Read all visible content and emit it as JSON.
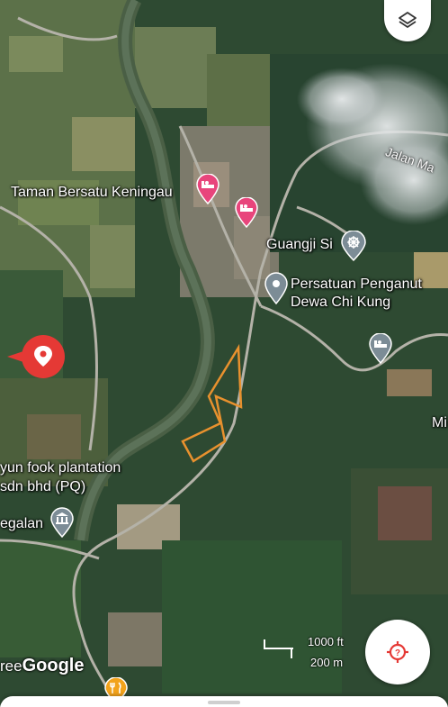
{
  "places": {
    "taman_bersatu": "Taman Bersatu Keningau",
    "guangji": "Guangji Si",
    "persatuan_line1": "Persatuan Penganut",
    "persatuan_line2": "Dewa Chi Kung",
    "yun_fook_line1": "yun fook plantation",
    "yun_fook_line2": "sdn bhd (PQ)",
    "egalan": "egalan",
    "mi_partial": "Mi"
  },
  "roads": {
    "jalan": "Jalan Ma"
  },
  "scale": {
    "imperial": "1000 ft",
    "metric": "200 m"
  },
  "attribution": {
    "prefix": "ree",
    "brand": "Google"
  },
  "icons": {
    "layers": "layers-icon",
    "locate": "locate-target-icon",
    "hotel": "hotel-bed-icon",
    "temple": "temple-wheel-icon",
    "museum": "museum-icon",
    "restaurant": "fork-knife-icon",
    "place": "place-pin-icon",
    "dropped_pin": "dropped-pin-icon"
  },
  "colors": {
    "selected_boundary": "#e8912e",
    "dropped_pin": "#e53935",
    "hotel_pin": "#e8457c",
    "poi_gray": "#7c8c96",
    "restaurant": "#f2a31b",
    "locate_accent": "#e53935"
  }
}
